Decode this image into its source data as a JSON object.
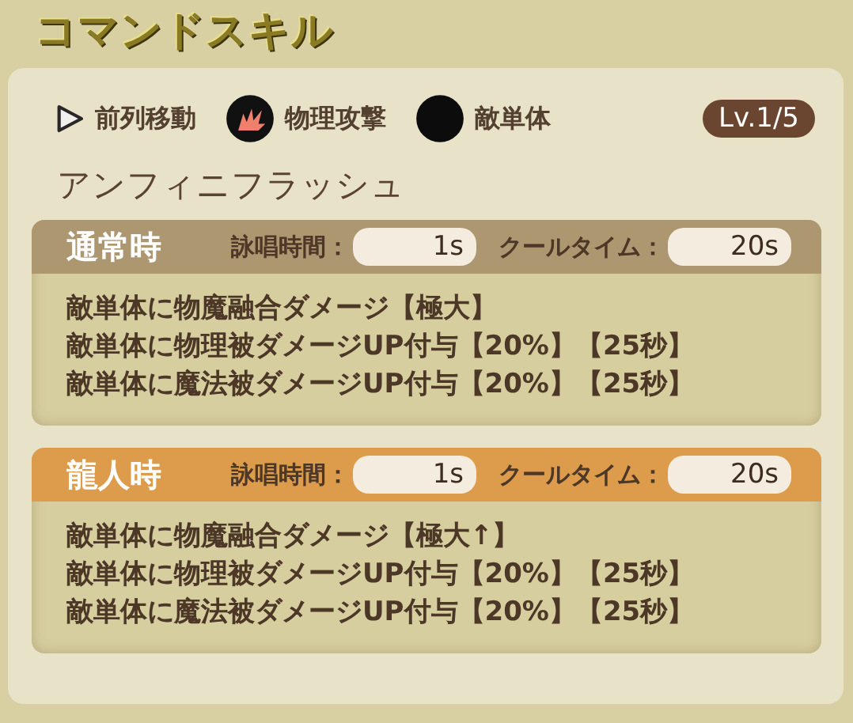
{
  "title": "コマンドスキル",
  "tags": [
    {
      "kind": "move",
      "label": "前列移動"
    },
    {
      "kind": "physical",
      "label": "物理攻撃"
    },
    {
      "kind": "target",
      "label": "敵単体"
    }
  ],
  "level": "Lv.1/5",
  "skill_name": "アンフィニフラッシュ",
  "sections": [
    {
      "kind": "normal",
      "title": "通常時",
      "cast_label": "詠唱時間：",
      "cast_value": "1s",
      "cooldown_label": "クールタイム：",
      "cooldown_value": "20s",
      "effects": [
        "敵単体に物魔融合ダメージ【極大】",
        "敵単体に物理被ダメージUP付与【20%】【25秒】",
        "敵単体に魔法被ダメージUP付与【20%】【25秒】"
      ]
    },
    {
      "kind": "dragon",
      "title": "龍人時",
      "cast_label": "詠唱時間：",
      "cast_value": "1s",
      "cooldown_label": "クールタイム：",
      "cooldown_value": "20s",
      "effects": [
        "敵単体に物魔融合ダメージ【極大↑】",
        "敵単体に物理被ダメージUP付与【20%】【25秒】",
        "敵単体に魔法被ダメージUP付与【20%】【25秒】"
      ]
    }
  ]
}
